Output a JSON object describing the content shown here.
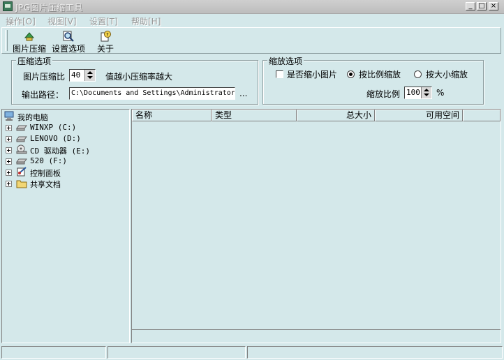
{
  "window": {
    "title": "JPG图片压缩工具"
  },
  "menu": [
    "操作[O]",
    "视图[V]",
    "设置[T]",
    "帮助[H]"
  ],
  "toolbar": {
    "compress_label": "图片压缩",
    "settings_label": "设置选项",
    "about_label": "关于"
  },
  "compression": {
    "group_title": "压缩选项",
    "ratio_label": "图片压缩比",
    "ratio_value": "40",
    "ratio_hint": "值越小压缩率越大",
    "output_label": "输出路径：",
    "output_value": "C:\\Documents and Settings\\Administrator",
    "browse_label": "..."
  },
  "scaling": {
    "group_title": "缩放选项",
    "shrink_label": "是否缩小图片",
    "shrink_checked": false,
    "proportional_label": "按比例缩放",
    "proportional_selected": true,
    "bysize_label": "按大小缩放",
    "scale_label": "缩放比例",
    "scale_value": "100",
    "scale_unit": "%"
  },
  "tree": [
    {
      "label": "我的电脑",
      "icon": "computer-icon"
    },
    {
      "label": "WINXP (C:)",
      "icon": "drive-icon"
    },
    {
      "label": "LENOVO (D:)",
      "icon": "drive-icon"
    },
    {
      "label": "CD 驱动器 (E:)",
      "icon": "cd-drive-icon"
    },
    {
      "label": "520 (F:)",
      "icon": "drive-icon"
    },
    {
      "label": "控制面板",
      "icon": "control-panel-icon"
    },
    {
      "label": "共享文档",
      "icon": "folder-icon"
    }
  ],
  "list": {
    "columns": [
      "名称",
      "类型",
      "总大小",
      "可用空间"
    ]
  },
  "colors": {
    "background": "#d4e8ea",
    "title_bar": "#c4c4c4",
    "disabled_text": "#9a9a9a"
  }
}
